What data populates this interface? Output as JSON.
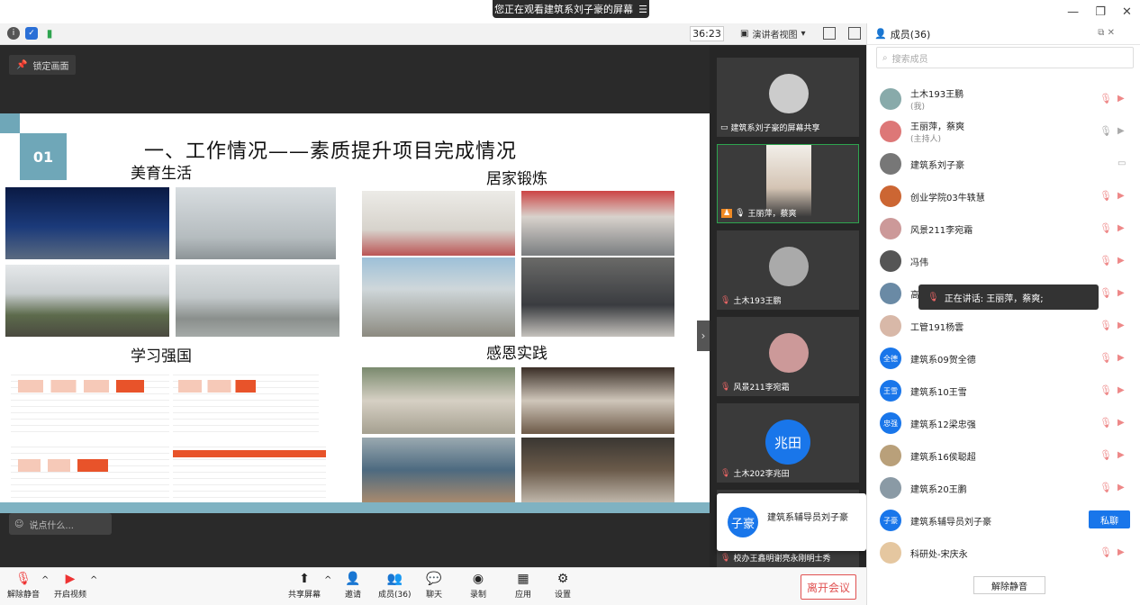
{
  "banner": {
    "text": "您正在观看建筑系刘子豪的屏幕",
    "menu_icon": "menu-icon"
  },
  "window": {
    "minimize": "—",
    "restore": "❐",
    "close": "✕"
  },
  "toolbar": {
    "timer": "36:23",
    "view_mode": "演讲者视图"
  },
  "stage": {
    "lock_label": "锁定画面",
    "comment_placeholder": "说点什么..."
  },
  "slide": {
    "number": "01",
    "title": "一、工作情况——素质提升项目完成情况",
    "sections": [
      "美育生活",
      "居家锻炼",
      "学习强国",
      "感恩实践"
    ]
  },
  "strip": {
    "tiles": [
      {
        "name": "建筑系刘子豪的屏幕共享",
        "kind": "share"
      },
      {
        "name": "王丽萍，蔡爽",
        "kind": "host"
      },
      {
        "name": "土木193王鹏",
        "kind": "muted"
      },
      {
        "name": "风景211李宛霜",
        "kind": "muted"
      },
      {
        "name": "土木202李兆田",
        "kind": "muted",
        "avatar_text": "兆田"
      },
      {
        "name": "校办王鑫明谢亮永刚明士秀",
        "kind": "muted"
      }
    ],
    "popcard": {
      "avatar_text": "子豪",
      "name": "建筑系辅导员刘子豪"
    }
  },
  "bottom_bar": {
    "items": [
      {
        "label": "解除静音",
        "icon": "mic-off-icon"
      },
      {
        "label": "开启视频",
        "icon": "camera-off-icon"
      },
      {
        "label": "共享屏幕",
        "icon": "share-screen-icon"
      },
      {
        "label": "邀请",
        "icon": "invite-icon"
      },
      {
        "label": "成员(36)",
        "icon": "members-icon"
      },
      {
        "label": "聊天",
        "icon": "chat-icon"
      },
      {
        "label": "录制",
        "icon": "record-icon"
      },
      {
        "label": "应用",
        "icon": "apps-icon"
      },
      {
        "label": "设置",
        "icon": "settings-icon"
      }
    ],
    "leave": "离开会议"
  },
  "panel": {
    "title": "成员(36)",
    "search_placeholder": "搜索成员",
    "members": [
      {
        "name": "土木193王鹏",
        "sub": "(我)"
      },
      {
        "name": "王丽萍，蔡爽",
        "sub": "(主持人)"
      },
      {
        "name": "建筑系刘子豪",
        "sub": ""
      },
      {
        "name": "创业学院03牛轶慧",
        "sub": ""
      },
      {
        "name": "风景211李宛霜",
        "sub": ""
      },
      {
        "name": "冯伟",
        "sub": ""
      },
      {
        "name": "高",
        "sub": ""
      },
      {
        "name": "工管191杨雲",
        "sub": ""
      },
      {
        "name": "建筑系09贺全德",
        "sub": "",
        "avatar_text": "全德"
      },
      {
        "name": "建筑系10王雪",
        "sub": "",
        "avatar_text": "王雪"
      },
      {
        "name": "建筑系12梁忠强",
        "sub": "",
        "avatar_text": "忠强"
      },
      {
        "name": "建筑系16侯聪超",
        "sub": ""
      },
      {
        "name": "建筑系20王鹏",
        "sub": ""
      },
      {
        "name": "建筑系辅导员刘子豪",
        "sub": "",
        "avatar_text": "子豪"
      },
      {
        "name": "科研处-宋庆永",
        "sub": ""
      }
    ],
    "private_chat": "私聊",
    "speaking_tooltip": "正在讲话: 王丽萍，蔡爽;",
    "unmute_all": "解除静音"
  }
}
